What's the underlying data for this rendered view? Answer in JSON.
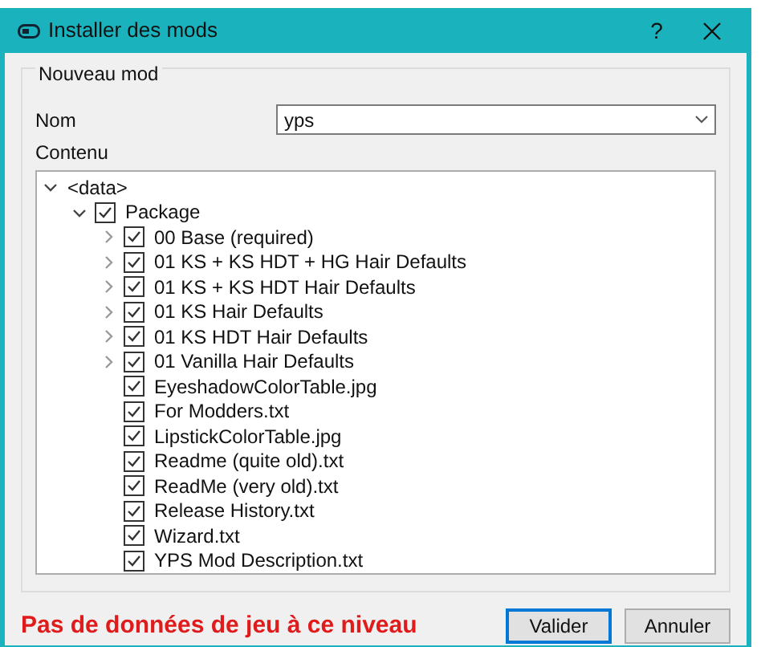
{
  "window": {
    "title": "Installer des mods",
    "help": "?"
  },
  "group": {
    "title": "Nouveau mod",
    "name_label": "Nom",
    "name_value": "yps",
    "content_label": "Contenu",
    "tree": [
      {
        "kind": "root",
        "label": "<data>",
        "expanded": true,
        "children": [
          {
            "kind": "folder",
            "label": "Package",
            "checked": true,
            "expanded": true,
            "children": [
              {
                "kind": "folder",
                "label": "00 Base (required)",
                "checked": true,
                "expanded": false
              },
              {
                "kind": "folder",
                "label": "01 KS + KS HDT + HG Hair Defaults",
                "checked": true,
                "expanded": false
              },
              {
                "kind": "folder",
                "label": "01 KS + KS HDT Hair Defaults",
                "checked": true,
                "expanded": false
              },
              {
                "kind": "folder",
                "label": "01 KS Hair Defaults",
                "checked": true,
                "expanded": false
              },
              {
                "kind": "folder",
                "label": "01 KS HDT Hair Defaults",
                "checked": true,
                "expanded": false
              },
              {
                "kind": "folder",
                "label": "01 Vanilla Hair Defaults",
                "checked": true,
                "expanded": false
              },
              {
                "kind": "file",
                "label": "EyeshadowColorTable.jpg",
                "checked": true
              },
              {
                "kind": "file",
                "label": "For Modders.txt",
                "checked": true
              },
              {
                "kind": "file",
                "label": "LipstickColorTable.jpg",
                "checked": true
              },
              {
                "kind": "file",
                "label": "Readme (quite old).txt",
                "checked": true
              },
              {
                "kind": "file",
                "label": "ReadMe (very old).txt",
                "checked": true
              },
              {
                "kind": "file",
                "label": "Release History.txt",
                "checked": true
              },
              {
                "kind": "file",
                "label": "Wizard.txt",
                "checked": true
              },
              {
                "kind": "file",
                "label": "YPS Mod Description.txt",
                "checked": true
              }
            ]
          }
        ]
      }
    ]
  },
  "warning": "Pas de données de jeu à ce niveau",
  "buttons": [
    {
      "label": "Valider",
      "selected": true
    },
    {
      "label": "Annuler",
      "selected": false
    }
  ]
}
